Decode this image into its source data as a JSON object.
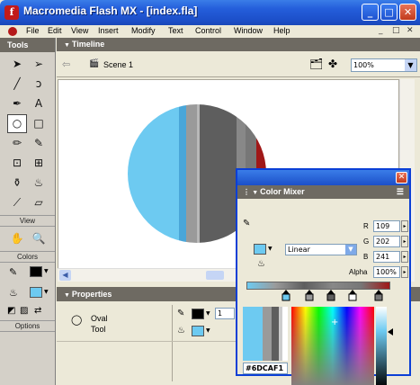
{
  "window": {
    "title": "Macromedia Flash MX - [index.fla]",
    "app_icon_glyph": "f",
    "minimize_glyph": "_",
    "maximize_glyph": "□",
    "close_glyph": "✕"
  },
  "menubar": {
    "items": [
      "File",
      "Edit",
      "View",
      "Insert",
      "Modify",
      "Text",
      "Control",
      "Window",
      "Help"
    ],
    "doc_controls": [
      "_",
      "□",
      "✕"
    ]
  },
  "tools_panel": {
    "title": "Tools",
    "tools": [
      {
        "icon": "arrow-tool-icon",
        "glyph": "➤"
      },
      {
        "icon": "subselect-tool-icon",
        "glyph": "➢"
      },
      {
        "icon": "line-tool-icon",
        "glyph": "╱"
      },
      {
        "icon": "lasso-tool-icon",
        "glyph": "ↄ"
      },
      {
        "icon": "pen-tool-icon",
        "glyph": "✒"
      },
      {
        "icon": "text-tool-icon",
        "glyph": "A"
      },
      {
        "icon": "oval-tool-icon",
        "glyph": "○",
        "selected": true
      },
      {
        "icon": "rectangle-tool-icon",
        "glyph": "□"
      },
      {
        "icon": "pencil-tool-icon",
        "glyph": "✏"
      },
      {
        "icon": "brush-tool-icon",
        "glyph": "✎"
      },
      {
        "icon": "free-transform-icon",
        "glyph": "⊡"
      },
      {
        "icon": "fill-transform-icon",
        "glyph": "⊞"
      },
      {
        "icon": "ink-bottle-icon",
        "glyph": "⚱"
      },
      {
        "icon": "paint-bucket-icon",
        "glyph": "♨"
      },
      {
        "icon": "eyedropper-icon",
        "glyph": "⟋"
      },
      {
        "icon": "eraser-icon",
        "glyph": "▱"
      }
    ],
    "view_label": "View",
    "view_tools": [
      {
        "icon": "hand-tool-icon",
        "glyph": "✋"
      },
      {
        "icon": "zoom-tool-icon",
        "glyph": "🔍"
      }
    ],
    "colors_label": "Colors",
    "options_label": "Options"
  },
  "timeline": {
    "title": "Timeline",
    "scene": "Scene 1",
    "zoom": "100%"
  },
  "properties": {
    "title": "Properties",
    "tool_name": "Oval",
    "tool_sub": "Tool",
    "stroke_width": "1"
  },
  "color_mixer": {
    "title": "Color Mixer",
    "fill_type": "Linear",
    "r_label": "R",
    "r_value": "109",
    "g_label": "G",
    "g_value": "202",
    "b_label": "B",
    "b_value": "241",
    "alpha_label": "Alpha",
    "alpha_value": "100%",
    "hex_value": "#6DCAF1"
  },
  "colors": {
    "gradient_stops": [
      "#6DCAF1",
      "#9a9a9a",
      "#5e5e5e",
      "#888888",
      "#777777",
      "#a01818"
    ],
    "accent": "#6DCAF1",
    "stroke": "#000000"
  }
}
